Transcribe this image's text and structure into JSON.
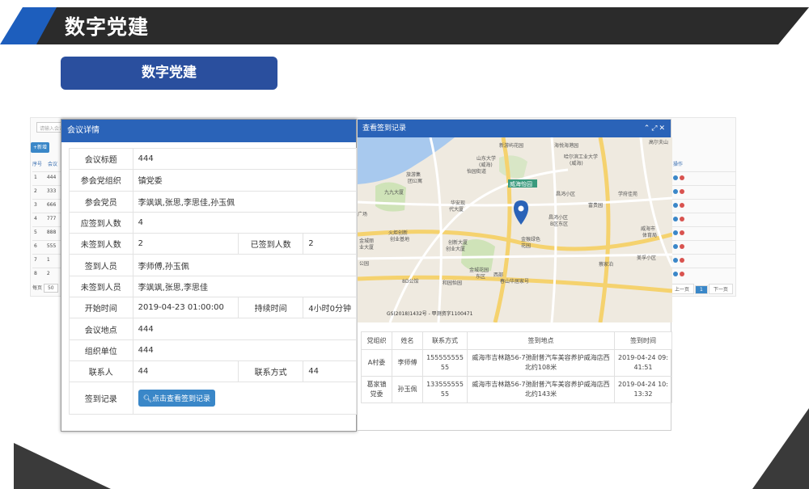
{
  "header": {
    "title": "数字党建"
  },
  "pill": {
    "label": "数字党建"
  },
  "background_list": {
    "search_placeholder": "请输入会议",
    "add_button": "+新增",
    "col_no": "序号",
    "col_name": "会议",
    "col_op": "操作",
    "rows": [
      {
        "no": "1",
        "name": "444"
      },
      {
        "no": "2",
        "name": "333"
      },
      {
        "no": "3",
        "name": "666"
      },
      {
        "no": "4",
        "name": "777"
      },
      {
        "no": "5",
        "name": "888"
      },
      {
        "no": "6",
        "name": "555"
      },
      {
        "no": "7",
        "name": "1"
      },
      {
        "no": "8",
        "name": "2"
      }
    ],
    "footer_label": "每页",
    "page_size": "50",
    "pager": {
      "prev": "上一页",
      "current": "1",
      "next": "下一页"
    }
  },
  "meeting_dialog": {
    "title": "会议详情",
    "fields": {
      "topic_label": "会议标题",
      "topic": "444",
      "org_label": "参会党组织",
      "org": "镇党委",
      "members_label": "参会党员",
      "members": "李飒飒,张思,李思佳,孙玉佩",
      "expected_label": "应签到人数",
      "expected": "4",
      "absent_count_label": "未签到人数",
      "absent_count": "2",
      "signed_count_label": "已签到人数",
      "signed_count": "2",
      "signed_label": "签到人员",
      "signed": "李师傅,孙玉佩",
      "absent_label": "未签到人员",
      "absent": "李飒飒,张思,李思佳",
      "start_label": "开始时间",
      "start": "2019-04-23 01:00:00",
      "duration_label": "持续时间",
      "duration": "4小时0分钟",
      "place_label": "会议地点",
      "place": "444",
      "unit_label": "组织单位",
      "unit": "444",
      "contact_label": "联系人",
      "contact": "44",
      "phone_label": "联系方式",
      "phone": "44",
      "record_label": "签到记录",
      "record_button": "点击查看签到记录"
    }
  },
  "record_dialog": {
    "title": "查看签到记录",
    "controls": "⌃⤢✕",
    "map": {
      "labels": [
        "新游屿花园",
        "山东大学",
        "(威海)",
        "怡园街道",
        "哈尔滨工业大学",
        "(威海)",
        "海悦海港园",
        "威海怡园",
        "旅游集",
        "团公寓",
        "九九大厦",
        "华安现",
        "代大厦",
        "昌鸿小区",
        "富贵园",
        "学府佳苑",
        "高尔夫山",
        "火炬创新",
        "创业基地",
        "创新大厦",
        "创业大厦",
        "昌鸿小区",
        "B区东区",
        "金猴绿色",
        "花园",
        "威海市",
        "体育局",
        "美孚小区",
        "蔡家泊",
        "金城花园",
        "东区",
        "西部",
        "春山华居家号",
        "8D公馆",
        "和园怡园",
        "广场",
        "金城丽",
        "业大厦",
        "公园"
      ],
      "copyright": "GS(2018)1432号 - 甲测资字1100471"
    },
    "table": {
      "headers": [
        "党组织",
        "姓名",
        "联系方式",
        "签到地点",
        "签到时间"
      ],
      "rows": [
        {
          "org": "A村委",
          "name": "李师傅",
          "phone": "15555555555",
          "place": "威海市吉林路56-7弛耐普汽车美容养护威海店西北约108米",
          "time": "2019-04-24 09:41:51"
        },
        {
          "org": "葛家镇党委",
          "name": "孙玉佩",
          "phone": "13355555555",
          "place": "威海市吉林路56-7弛耐普汽车美容养护威海店西北约143米",
          "time": "2019-04-24 10:13:32"
        }
      ]
    }
  },
  "colors": {
    "accent": "#2a63b8",
    "header_dark": "#2b2b2b",
    "header_blue": "#1d5ebd",
    "pill": "#2a4f9e",
    "button": "#3a87c8"
  }
}
